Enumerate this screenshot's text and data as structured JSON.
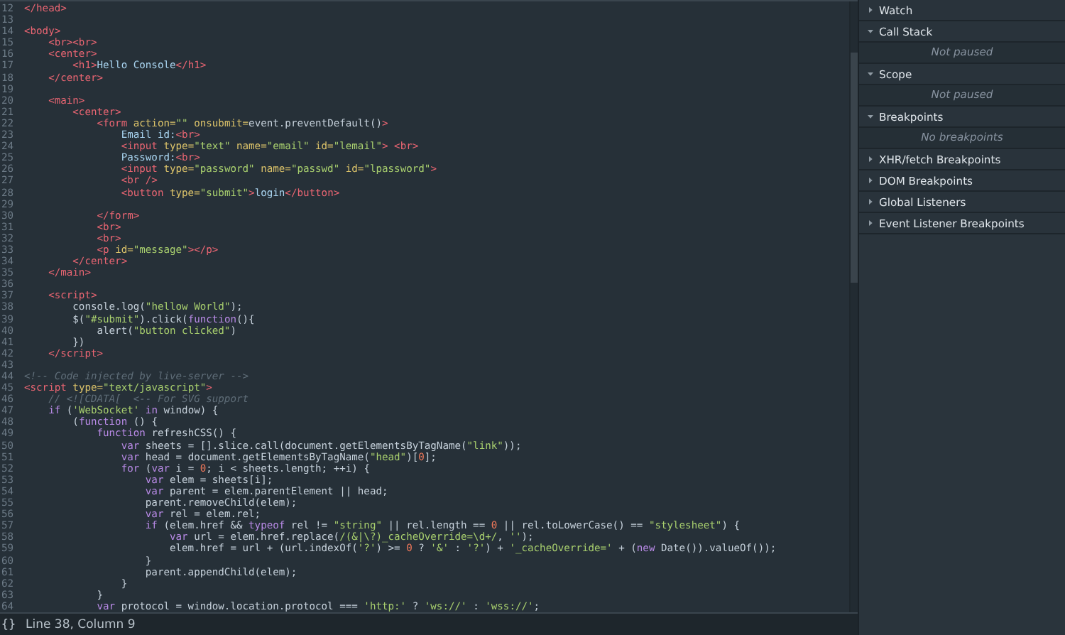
{
  "editor": {
    "lines": [
      {
        "number": "12",
        "tokens": [
          {
            "text": "</head>",
            "kind": "tag"
          }
        ]
      },
      {
        "number": "13"
      },
      {
        "number": "14",
        "tokens": [
          {
            "text": "<body>",
            "kind": "tag"
          }
        ]
      },
      {
        "number": "15",
        "tokens": [
          {
            "text": "    <br><br>",
            "kind": "tag"
          }
        ]
      },
      {
        "number": "16",
        "tokens": [
          {
            "text": "    <center>",
            "kind": "tag"
          }
        ]
      },
      {
        "number": "17",
        "tokens": [
          {
            "text": "        <h1>",
            "kind": "tag"
          },
          {
            "text": "Hello Console",
            "kind": "content"
          },
          {
            "text": "</h1>",
            "kind": "tag"
          }
        ]
      },
      {
        "number": "18",
        "tokens": [
          {
            "text": "    </center>",
            "kind": "tag"
          }
        ]
      },
      {
        "number": "19"
      },
      {
        "number": "20",
        "tokens": [
          {
            "text": "    <main>",
            "kind": "tag"
          }
        ]
      },
      {
        "number": "21",
        "tokens": [
          {
            "text": "        <center>",
            "kind": "tag"
          }
        ]
      },
      {
        "number": "22",
        "tokens": [
          {
            "text": "            <form ",
            "kind": "tag"
          },
          {
            "text": "action=",
            "kind": "attr"
          },
          {
            "text": "\"\"",
            "kind": "string"
          },
          {
            "text": " onsubmit=",
            "kind": "attr"
          },
          {
            "text": "event.preventDefault()",
            "kind": "text"
          },
          {
            "text": ">",
            "kind": "tag"
          }
        ]
      },
      {
        "number": "23",
        "tokens": [
          {
            "text": "                Email id:",
            "kind": "content"
          },
          {
            "text": "<br>",
            "kind": "tag"
          }
        ]
      },
      {
        "number": "24",
        "tokens": [
          {
            "text": "                <input ",
            "kind": "tag"
          },
          {
            "text": "type=",
            "kind": "attr"
          },
          {
            "text": "\"text\"",
            "kind": "string"
          },
          {
            "text": " name=",
            "kind": "attr"
          },
          {
            "text": "\"email\"",
            "kind": "string"
          },
          {
            "text": " id=",
            "kind": "attr"
          },
          {
            "text": "\"lemail\"",
            "kind": "string"
          },
          {
            "text": "> <br>",
            "kind": "tag"
          }
        ]
      },
      {
        "number": "25",
        "tokens": [
          {
            "text": "                Password:",
            "kind": "content"
          },
          {
            "text": "<br>",
            "kind": "tag"
          }
        ]
      },
      {
        "number": "26",
        "tokens": [
          {
            "text": "                <input ",
            "kind": "tag"
          },
          {
            "text": "type=",
            "kind": "attr"
          },
          {
            "text": "\"password\"",
            "kind": "string"
          },
          {
            "text": " name=",
            "kind": "attr"
          },
          {
            "text": "\"passwd\"",
            "kind": "string"
          },
          {
            "text": " id=",
            "kind": "attr"
          },
          {
            "text": "\"lpassword\"",
            "kind": "string"
          },
          {
            "text": ">",
            "kind": "tag"
          }
        ]
      },
      {
        "number": "27",
        "tokens": [
          {
            "text": "                <br />",
            "kind": "tag"
          }
        ]
      },
      {
        "number": "28",
        "tokens": [
          {
            "text": "                <button ",
            "kind": "tag"
          },
          {
            "text": "type=",
            "kind": "attr"
          },
          {
            "text": "\"submit\"",
            "kind": "string"
          },
          {
            "text": ">",
            "kind": "tag"
          },
          {
            "text": "login",
            "kind": "content"
          },
          {
            "text": "</button>",
            "kind": "tag"
          }
        ]
      },
      {
        "number": "29"
      },
      {
        "number": "30",
        "tokens": [
          {
            "text": "            </form>",
            "kind": "tag"
          }
        ]
      },
      {
        "number": "31",
        "tokens": [
          {
            "text": "            <br>",
            "kind": "tag"
          }
        ]
      },
      {
        "number": "32",
        "tokens": [
          {
            "text": "            <br>",
            "kind": "tag"
          }
        ]
      },
      {
        "number": "33",
        "tokens": [
          {
            "text": "            <p ",
            "kind": "tag"
          },
          {
            "text": "id=",
            "kind": "attr"
          },
          {
            "text": "\"message\"",
            "kind": "string"
          },
          {
            "text": "></p>",
            "kind": "tag"
          }
        ]
      },
      {
        "number": "34",
        "tokens": [
          {
            "text": "        </center>",
            "kind": "tag"
          }
        ]
      },
      {
        "number": "35",
        "tokens": [
          {
            "text": "    </main>",
            "kind": "tag"
          }
        ]
      },
      {
        "number": "36"
      },
      {
        "number": "37",
        "tokens": [
          {
            "text": "    <script>",
            "kind": "tag"
          }
        ]
      },
      {
        "number": "38",
        "tokens": [
          {
            "text": "        console.log(",
            "kind": "text"
          },
          {
            "text": "\"hellow World\"",
            "kind": "string"
          },
          {
            "text": ");",
            "kind": "text"
          }
        ]
      },
      {
        "number": "39",
        "tokens": [
          {
            "text": "        $(",
            "kind": "text"
          },
          {
            "text": "\"#submit\"",
            "kind": "string"
          },
          {
            "text": ").click(",
            "kind": "text"
          },
          {
            "text": "function",
            "kind": "keyword"
          },
          {
            "text": "(){",
            "kind": "text"
          }
        ]
      },
      {
        "number": "40",
        "tokens": [
          {
            "text": "            alert(",
            "kind": "text"
          },
          {
            "text": "\"button clicked\"",
            "kind": "string"
          },
          {
            "text": ")",
            "kind": "text"
          }
        ]
      },
      {
        "number": "41",
        "tokens": [
          {
            "text": "        })",
            "kind": "text"
          }
        ]
      },
      {
        "number": "42",
        "tokens": [
          {
            "text": "    </script>",
            "kind": "tag"
          }
        ]
      },
      {
        "number": "43"
      },
      {
        "number": "44",
        "tokens": [
          {
            "text": "<!-- Code injected by live-server -->",
            "kind": "comment"
          }
        ]
      },
      {
        "number": "45",
        "tokens": [
          {
            "text": "<script ",
            "kind": "tag"
          },
          {
            "text": "type=",
            "kind": "attr"
          },
          {
            "text": "\"text/javascript\"",
            "kind": "string"
          },
          {
            "text": ">",
            "kind": "tag"
          }
        ]
      },
      {
        "number": "46",
        "tokens": [
          {
            "text": "    // <![CDATA[  <-- For SVG support",
            "kind": "comment"
          }
        ]
      },
      {
        "number": "47",
        "tokens": [
          {
            "text": "    if",
            "kind": "keyword"
          },
          {
            "text": " (",
            "kind": "text"
          },
          {
            "text": "'WebSocket'",
            "kind": "string"
          },
          {
            "text": " in",
            "kind": "keyword"
          },
          {
            "text": " window) {",
            "kind": "text"
          }
        ]
      },
      {
        "number": "48",
        "tokens": [
          {
            "text": "        (",
            "kind": "text"
          },
          {
            "text": "function",
            "kind": "keyword"
          },
          {
            "text": " () {",
            "kind": "text"
          }
        ]
      },
      {
        "number": "49",
        "tokens": [
          {
            "text": "            function",
            "kind": "keyword"
          },
          {
            "text": " refreshCSS() {",
            "kind": "text"
          }
        ]
      },
      {
        "number": "50",
        "tokens": [
          {
            "text": "                var",
            "kind": "keyword"
          },
          {
            "text": " sheets = [].slice.call(document.getElementsByTagName(",
            "kind": "text"
          },
          {
            "text": "\"link\"",
            "kind": "string"
          },
          {
            "text": "));",
            "kind": "text"
          }
        ]
      },
      {
        "number": "51",
        "tokens": [
          {
            "text": "                var",
            "kind": "keyword"
          },
          {
            "text": " head = document.getElementsByTagName(",
            "kind": "text"
          },
          {
            "text": "\"head\"",
            "kind": "string"
          },
          {
            "text": ")[",
            "kind": "text"
          },
          {
            "text": "0",
            "kind": "number"
          },
          {
            "text": "];",
            "kind": "text"
          }
        ]
      },
      {
        "number": "52",
        "tokens": [
          {
            "text": "                for",
            "kind": "keyword"
          },
          {
            "text": " (",
            "kind": "text"
          },
          {
            "text": "var",
            "kind": "keyword"
          },
          {
            "text": " i = ",
            "kind": "text"
          },
          {
            "text": "0",
            "kind": "number"
          },
          {
            "text": "; i < sheets.length; ++i) {",
            "kind": "text"
          }
        ]
      },
      {
        "number": "53",
        "tokens": [
          {
            "text": "                    var",
            "kind": "keyword"
          },
          {
            "text": " elem = sheets[i];",
            "kind": "text"
          }
        ]
      },
      {
        "number": "54",
        "tokens": [
          {
            "text": "                    var",
            "kind": "keyword"
          },
          {
            "text": " parent = elem.parentElement || head;",
            "kind": "text"
          }
        ]
      },
      {
        "number": "55",
        "tokens": [
          {
            "text": "                    parent.removeChild(elem);",
            "kind": "text"
          }
        ]
      },
      {
        "number": "56",
        "tokens": [
          {
            "text": "                    var",
            "kind": "keyword"
          },
          {
            "text": " rel = elem.rel;",
            "kind": "text"
          }
        ]
      },
      {
        "number": "57",
        "tokens": [
          {
            "text": "                    if",
            "kind": "keyword"
          },
          {
            "text": " (elem.href && ",
            "kind": "text"
          },
          {
            "text": "typeof",
            "kind": "keyword"
          },
          {
            "text": " rel != ",
            "kind": "text"
          },
          {
            "text": "\"string\"",
            "kind": "string"
          },
          {
            "text": " || rel.length == ",
            "kind": "text"
          },
          {
            "text": "0",
            "kind": "number"
          },
          {
            "text": " || rel.toLowerCase() == ",
            "kind": "text"
          },
          {
            "text": "\"stylesheet\"",
            "kind": "string"
          },
          {
            "text": ") {",
            "kind": "text"
          }
        ]
      },
      {
        "number": "58",
        "tokens": [
          {
            "text": "                        var",
            "kind": "keyword"
          },
          {
            "text": " url = elem.href.replace(",
            "kind": "text"
          },
          {
            "text": "/(&|\\?)_cacheOverride=\\d+/",
            "kind": "string"
          },
          {
            "text": ", ",
            "kind": "text"
          },
          {
            "text": "''",
            "kind": "string"
          },
          {
            "text": ");",
            "kind": "text"
          }
        ]
      },
      {
        "number": "59",
        "tokens": [
          {
            "text": "                        elem.href = url + (url.indexOf(",
            "kind": "text"
          },
          {
            "text": "'?'",
            "kind": "string"
          },
          {
            "text": ") >= ",
            "kind": "text"
          },
          {
            "text": "0",
            "kind": "number"
          },
          {
            "text": " ? ",
            "kind": "text"
          },
          {
            "text": "'&'",
            "kind": "string"
          },
          {
            "text": " : ",
            "kind": "text"
          },
          {
            "text": "'?'",
            "kind": "string"
          },
          {
            "text": ") + ",
            "kind": "text"
          },
          {
            "text": "'_cacheOverride='",
            "kind": "string"
          },
          {
            "text": " + (",
            "kind": "text"
          },
          {
            "text": "new",
            "kind": "keyword"
          },
          {
            "text": " Date()).valueOf());",
            "kind": "text"
          }
        ]
      },
      {
        "number": "60",
        "tokens": [
          {
            "text": "                    }",
            "kind": "text"
          }
        ]
      },
      {
        "number": "61",
        "tokens": [
          {
            "text": "                    parent.appendChild(elem);",
            "kind": "text"
          }
        ]
      },
      {
        "number": "62",
        "tokens": [
          {
            "text": "                }",
            "kind": "text"
          }
        ]
      },
      {
        "number": "63",
        "tokens": [
          {
            "text": "            }",
            "kind": "text"
          }
        ]
      },
      {
        "number": "64",
        "tokens": [
          {
            "text": "            var",
            "kind": "keyword"
          },
          {
            "text": " protocol = window.location.protocol === ",
            "kind": "text"
          },
          {
            "text": "'http:'",
            "kind": "string"
          },
          {
            "text": " ? ",
            "kind": "text"
          },
          {
            "text": "'ws://'",
            "kind": "string"
          },
          {
            "text": " : ",
            "kind": "text"
          },
          {
            "text": "'wss://'",
            "kind": "string"
          },
          {
            "text": ";",
            "kind": "text"
          }
        ]
      }
    ]
  },
  "status_bar": {
    "icon": "{}",
    "position": "Line 38, Column 9"
  },
  "sidebar": {
    "sections": [
      {
        "title": "Watch",
        "expanded": false
      },
      {
        "title": "Call Stack",
        "expanded": true,
        "message": "Not paused"
      },
      {
        "title": "Scope",
        "expanded": true,
        "message": "Not paused"
      },
      {
        "title": "Breakpoints",
        "expanded": true,
        "message": "No breakpoints"
      },
      {
        "title": "XHR/fetch Breakpoints",
        "expanded": false
      },
      {
        "title": "DOM Breakpoints",
        "expanded": false
      },
      {
        "title": "Global Listeners",
        "expanded": false
      },
      {
        "title": "Event Listener Breakpoints",
        "expanded": false
      }
    ]
  }
}
